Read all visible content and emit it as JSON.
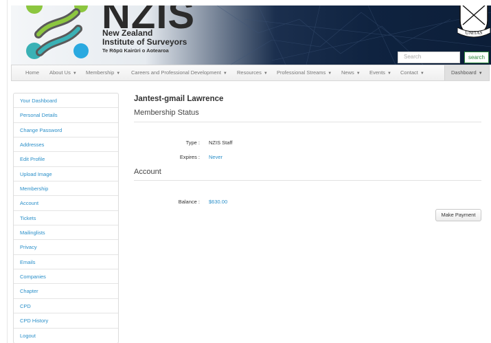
{
  "brand": {
    "abbr": "NZIS",
    "name_line1": "New Zealand",
    "name_line2": "Institute of Surveyors",
    "tagline": "Te Rōpū Kairūri o Aotearoa",
    "crest_text": "UNITAS",
    "colors": {
      "green": "#8cc63f",
      "teal": "#3ab1b5",
      "blue": "#2aa9e0",
      "dark": "#1b2f4e"
    }
  },
  "search": {
    "placeholder": "Search",
    "button_label": "search"
  },
  "nav": {
    "items": [
      {
        "label": "Home",
        "dropdown": false
      },
      {
        "label": "About Us",
        "dropdown": true
      },
      {
        "label": "Membership",
        "dropdown": true
      },
      {
        "label": "Careers and Professional Development",
        "dropdown": true
      },
      {
        "label": "Resources",
        "dropdown": true
      },
      {
        "label": "Professional Streams",
        "dropdown": true
      },
      {
        "label": "News",
        "dropdown": true
      },
      {
        "label": "Events",
        "dropdown": true
      },
      {
        "label": "Contact",
        "dropdown": true
      }
    ],
    "dashboard": {
      "label": "Dashboard",
      "dropdown": true
    }
  },
  "sidebar": {
    "items": [
      "Your Dashboard",
      "Personal Details",
      "Change Password",
      "Addresses",
      "Edit Profile",
      "Upload Image",
      "Membership",
      "Account",
      "Tickets",
      "Mailinglists",
      "Privacy",
      "Emails",
      "Companies",
      "Chapter",
      "CPD",
      "CPD History",
      "Logout"
    ]
  },
  "main": {
    "user_name": "Jantest-gmail Lawrence",
    "membership": {
      "title": "Membership Status",
      "type_label": "Type :",
      "type_value": "NZIS Staff",
      "expires_label": "Expires :",
      "expires_value": "Never"
    },
    "account": {
      "title": "Account",
      "balance_label": "Balance :",
      "balance_value": "$630.00",
      "pay_button": "Make Payment"
    }
  }
}
